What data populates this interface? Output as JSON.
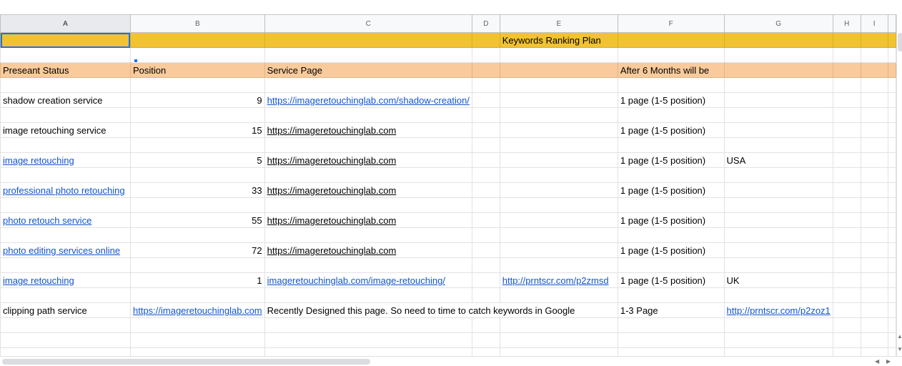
{
  "columns": [
    "A",
    "B",
    "C",
    "D",
    "E",
    "F",
    "G",
    "H",
    "I"
  ],
  "title": "Keywords Ranking Plan",
  "header": {
    "status": "Preseant Status",
    "position": "Position",
    "service_page": "Service Page",
    "after": "After 6 Months will be"
  },
  "rows": [
    {
      "keyword": "shadow creation service",
      "keyword_link": false,
      "position": "9",
      "page": "https://imageretouchinglab.com/shadow-creation/",
      "page_style": "blue",
      "extra": "",
      "after": "1 page (1-5 position)",
      "country": ""
    },
    {
      "keyword": "image retouching service",
      "keyword_link": false,
      "position": "15",
      "page": "https://imageretouchinglab.com",
      "page_style": "dark",
      "extra": "",
      "after": "1 page (1-5 position)",
      "country": ""
    },
    {
      "keyword": "image retouching",
      "keyword_link": true,
      "position": "5",
      "page": "https://imageretouchinglab.com",
      "page_style": "dark",
      "extra": "",
      "after": "1 page (1-5 position)",
      "country": "USA"
    },
    {
      "keyword": "professional photo retouching",
      "keyword_link": true,
      "position": "33",
      "page": "https://imageretouchinglab.com",
      "page_style": "dark",
      "extra": "",
      "after": "1 page (1-5 position)",
      "country": ""
    },
    {
      "keyword": "photo retouch service",
      "keyword_link": true,
      "position": "55",
      "page": "https://imageretouchinglab.com",
      "page_style": "dark",
      "extra": "",
      "after": "1 page (1-5 position)",
      "country": ""
    },
    {
      "keyword": "photo editing services online",
      "keyword_link": true,
      "position": "72",
      "page": "https://imageretouchinglab.com",
      "page_style": "dark",
      "extra": "",
      "after": "1 page (1-5 position)",
      "country": ""
    },
    {
      "keyword": "image retouching",
      "keyword_link": true,
      "position": "1",
      "page": "imageretouchinglab.com/image-retouching/",
      "page_style": "blue",
      "extra": "http://prntscr.com/p2zmsd",
      "after": "1 page (1-5 position)",
      "country": "UK"
    }
  ],
  "last_row": {
    "keyword": "clipping path service",
    "link": "https://imageretouchinglab.com",
    "note": "Recently Designed this page. So need to time to catch keywords in Google",
    "after": "1-3 Page",
    "g_link": "http://prntscr.com/p2zoz1"
  },
  "colors": {
    "title_fill": "#f1c232",
    "header_fill": "#f9cb9c",
    "link": "#1155cc",
    "selection": "#1a73e8"
  }
}
